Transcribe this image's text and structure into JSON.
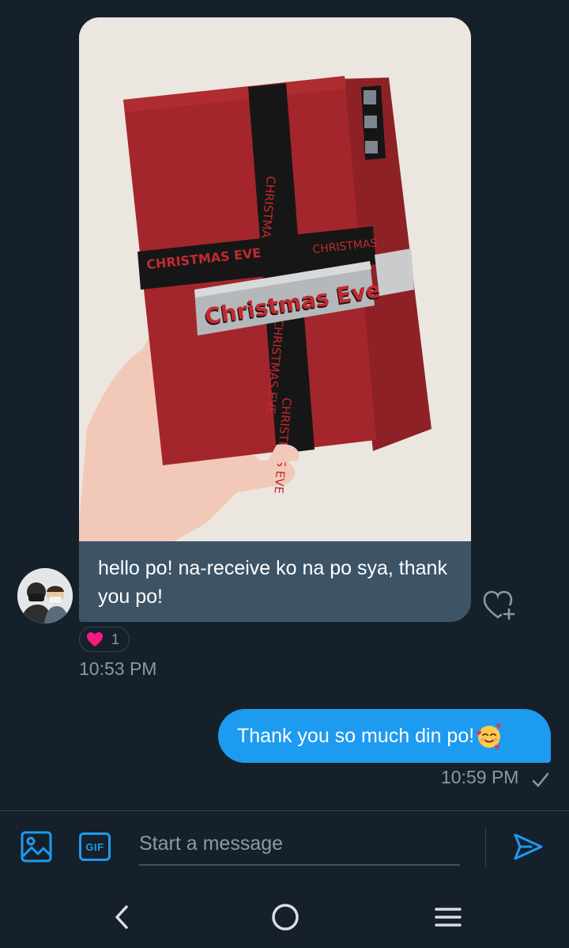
{
  "conversation": {
    "received": {
      "photo_texts": [
        "Christmas Eve"
      ],
      "message": "hello po! na-receive ko na po sya, thank you po!",
      "reaction": {
        "icon": "heart-icon",
        "count": "1"
      },
      "time": "10:53 PM"
    },
    "sent": {
      "message": "Thank you so much din po!",
      "emoji": "smiling-face-with-hearts-emoji",
      "time": "10:59 PM"
    }
  },
  "composer": {
    "placeholder": "Start a message",
    "gif_label": "GIF"
  },
  "colors": {
    "background": "#15202b",
    "received_bubble": "#3d5466",
    "sent_bubble": "#1d9bf0",
    "accent": "#1d9bf0",
    "muted_text": "#8b98a5",
    "like": "#f91880"
  }
}
